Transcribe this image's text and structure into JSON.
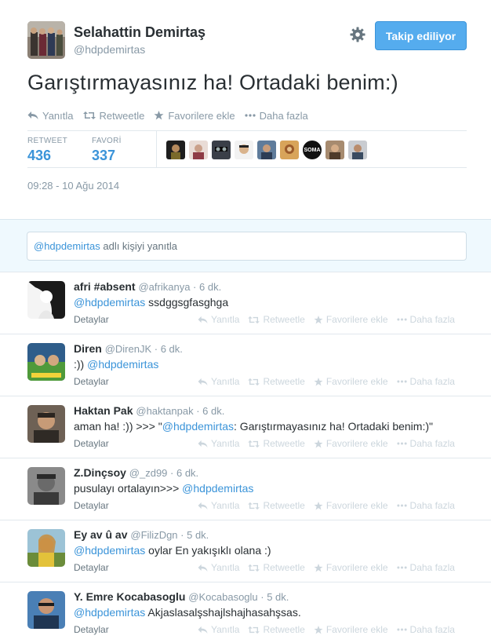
{
  "main_tweet": {
    "name": "Selahattin Demirtaş",
    "handle": "@hdpdemirtas",
    "follow_label": "Takip ediliyor",
    "text": "Garıştırmayasınız ha! Ortadaki benim:)",
    "actions": [
      "Yanıtla",
      "Retweetle",
      "Favorilere ekle",
      "Daha fazla"
    ],
    "retweet_label": "RETWEET",
    "retweet_count": "436",
    "favorite_label": "FAVORİ",
    "favorite_count": "337",
    "timestamp": "09:28 - 10 Ağu 2014",
    "soma_badge": "SOMA"
  },
  "reply_box": {
    "mention": "@hdpdemirtas",
    "placeholder_rest": " adlı kişiyi yanıtla"
  },
  "reply_actions": [
    "Yanıtla",
    "Retweetle",
    "Favorilere ekle",
    "Daha fazla"
  ],
  "details_label": "Detaylar",
  "replies": [
    {
      "name": "afri #absent",
      "handle": "@afrikanya",
      "time": "6 dk.",
      "parts": [
        {
          "m": "@hdpdemirtas"
        },
        {
          "t": " ssdggsgfasghga"
        }
      ]
    },
    {
      "name": "Diren",
      "handle": "@DirenJK",
      "time": "6 dk.",
      "parts": [
        {
          "t": ":)) "
        },
        {
          "m": "@hdpdemirtas"
        }
      ]
    },
    {
      "name": "Haktan Pak",
      "handle": "@haktanpak",
      "time": "6 dk.",
      "parts": [
        {
          "t": "aman ha! :)) >>> \""
        },
        {
          "m": "@hdpdemirtas"
        },
        {
          "t": ": Garıştırmayasınız ha! Ortadaki benim:)\""
        }
      ]
    },
    {
      "name": "Z.Dinçsoy",
      "handle": "@_zd99",
      "time": "6 dk.",
      "parts": [
        {
          "t": "pusulayı ortalayın>>> "
        },
        {
          "m": "@hdpdemirtas"
        }
      ]
    },
    {
      "name": "Ey av û av",
      "handle": "@FilizDgn",
      "time": "5 dk.",
      "parts": [
        {
          "m": "@hdpdemirtas"
        },
        {
          "t": " oylar  En yakışıklı olana :)"
        }
      ]
    },
    {
      "name": "Y. Emre Kocabasoglu",
      "handle": "@Kocabasoglu",
      "time": "5 dk.",
      "parts": [
        {
          "m": "@hdpdemirtas"
        },
        {
          "t": " Akjaslasalşshajlshajhasahşsas."
        }
      ]
    }
  ],
  "colors": {
    "accent": "#55acee",
    "link": "#3b94d9",
    "muted": "#8899a6"
  }
}
